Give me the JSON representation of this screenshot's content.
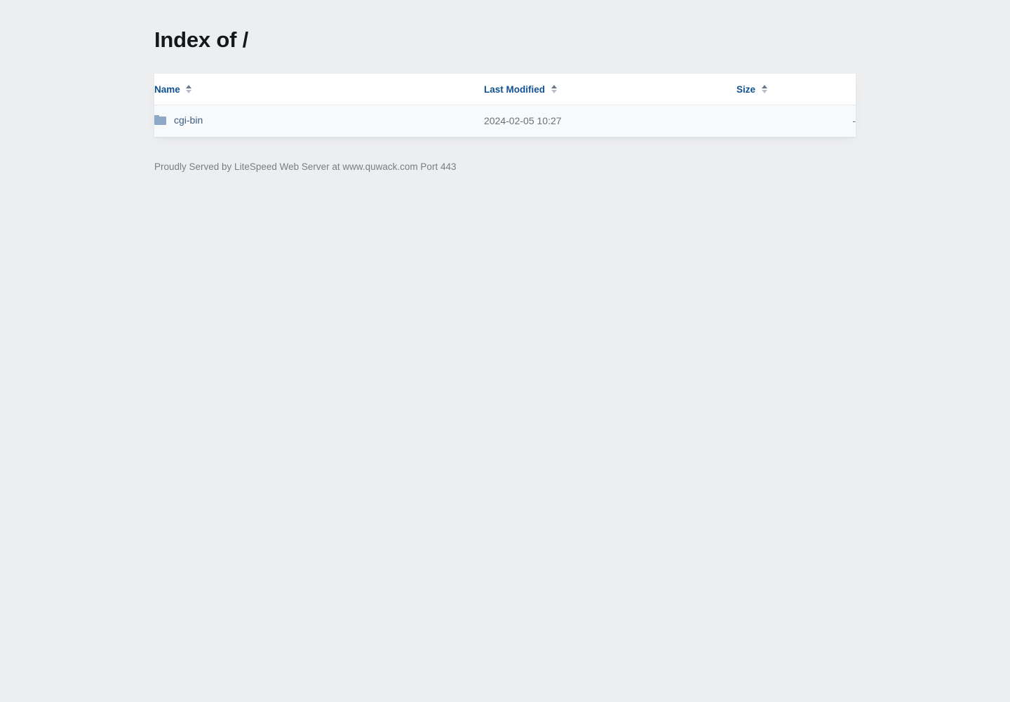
{
  "page": {
    "title": "Index of /"
  },
  "table": {
    "columns": [
      {
        "label": "Name",
        "sort_icon": "sort-icon",
        "align": "left"
      },
      {
        "label": "Last Modified",
        "sort_icon": "sort-icon",
        "align": "left"
      },
      {
        "label": "Size",
        "sort_icon": "sort-icon",
        "align": "right"
      }
    ],
    "rows": [
      {
        "icon": "folder-icon",
        "name": "cgi-bin",
        "last_modified": "2024-02-05 10:27",
        "size": "-"
      }
    ]
  },
  "footer": {
    "text": "Proudly Served by LiteSpeed Web Server at www.quwack.com Port 443"
  },
  "colors": {
    "page_background": "#edeef0",
    "card_background": "#ffffff",
    "row_background": "#f7f9fb",
    "header_link": "#125190",
    "entry_link": "#3c5b82",
    "folder_icon": "#8ea8c8",
    "muted_text": "#6a7279",
    "title_text": "#14181c"
  }
}
